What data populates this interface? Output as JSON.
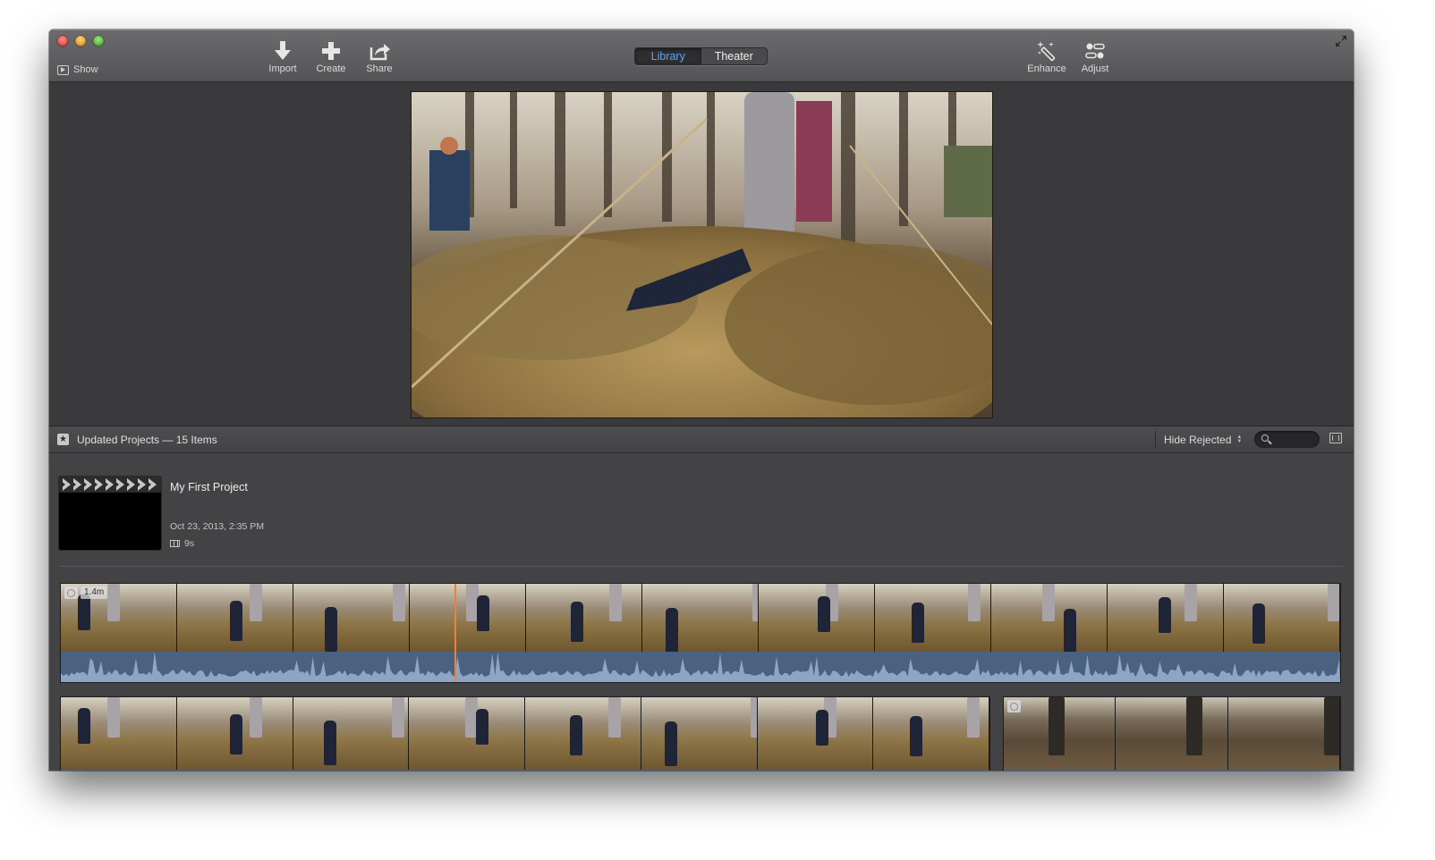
{
  "window": {
    "title_controls": [
      "close",
      "minimize",
      "zoom"
    ]
  },
  "toolbar": {
    "show_label": "Show",
    "import_label": "Import",
    "create_label": "Create",
    "share_label": "Share",
    "tabs": [
      {
        "label": "Library",
        "active": true
      },
      {
        "label": "Theater",
        "active": false
      }
    ],
    "enhance_label": "Enhance",
    "adjust_label": "Adjust",
    "accent_color": "#5aa6f0"
  },
  "viewer": {
    "icon": "video-preview"
  },
  "library": {
    "title": "Updated Projects — 15 Items",
    "filter_label": "Hide Rejected",
    "search_placeholder": ""
  },
  "project": {
    "name": "My First Project",
    "date": "Oct 23, 2013, 2:35 PM",
    "duration": "9s"
  },
  "clips": [
    {
      "duration_badge": "1.4m",
      "frame_count": 11,
      "has_audio": true,
      "playhead_fraction": 0.308
    },
    {
      "duration_badge": "",
      "frame_count": 8,
      "has_audio": false
    },
    {
      "duration_badge": "",
      "frame_count": 3,
      "has_audio": false
    }
  ],
  "colors": {
    "playhead": "#e8833a",
    "audio_waveform_bg": "#4a6180",
    "audio_waveform": "#8ea5c6"
  }
}
